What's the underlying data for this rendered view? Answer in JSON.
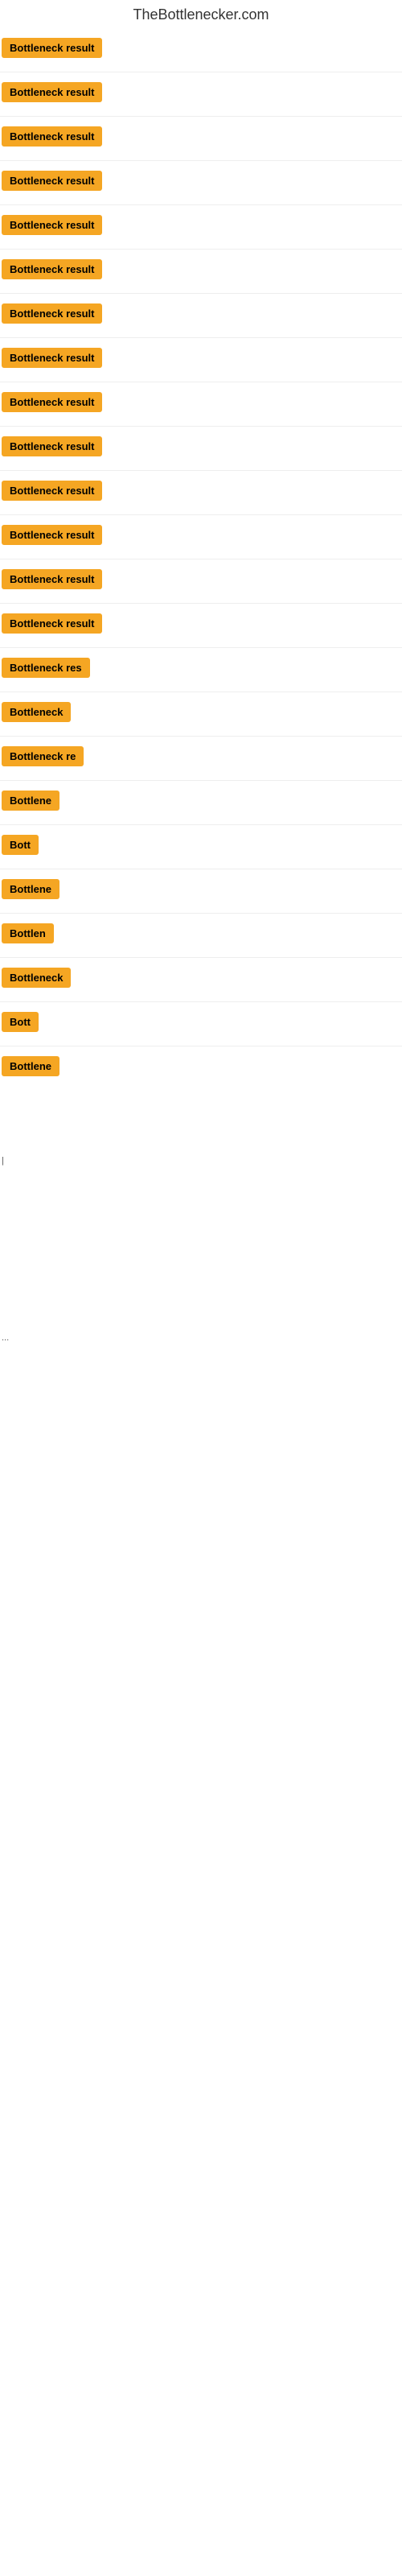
{
  "site": {
    "title": "TheBottlenecker.com"
  },
  "items": [
    {
      "label": "Bottleneck result",
      "width": "full"
    },
    {
      "label": "Bottleneck result",
      "width": "full"
    },
    {
      "label": "Bottleneck result",
      "width": "full"
    },
    {
      "label": "Bottleneck result",
      "width": "full"
    },
    {
      "label": "Bottleneck result",
      "width": "full"
    },
    {
      "label": "Bottleneck result",
      "width": "full"
    },
    {
      "label": "Bottleneck result",
      "width": "full"
    },
    {
      "label": "Bottleneck result",
      "width": "full"
    },
    {
      "label": "Bottleneck result",
      "width": "full"
    },
    {
      "label": "Bottleneck result",
      "width": "full"
    },
    {
      "label": "Bottleneck result",
      "width": "full"
    },
    {
      "label": "Bottleneck result",
      "width": "full"
    },
    {
      "label": "Bottleneck result",
      "width": "full"
    },
    {
      "label": "Bottleneck result",
      "width": "full"
    },
    {
      "label": "Bottleneck res",
      "width": "partial-lg"
    },
    {
      "label": "Bottleneck",
      "width": "partial-md"
    },
    {
      "label": "Bottleneck re",
      "width": "partial-lg2"
    },
    {
      "label": "Bottlene",
      "width": "partial-sm"
    },
    {
      "label": "Bott",
      "width": "tiny"
    },
    {
      "label": "Bottlene",
      "width": "partial-sm"
    },
    {
      "label": "Bottlen",
      "width": "partial-sm2"
    },
    {
      "label": "Bottleneck",
      "width": "partial-md"
    },
    {
      "label": "Bott",
      "width": "tiny"
    },
    {
      "label": "Bottlene",
      "width": "partial-sm"
    }
  ],
  "markers": [
    {
      "text": "|"
    },
    {
      "text": "..."
    }
  ],
  "colors": {
    "badge_bg": "#f5a623",
    "badge_text": "#000000",
    "title_color": "#333333"
  }
}
